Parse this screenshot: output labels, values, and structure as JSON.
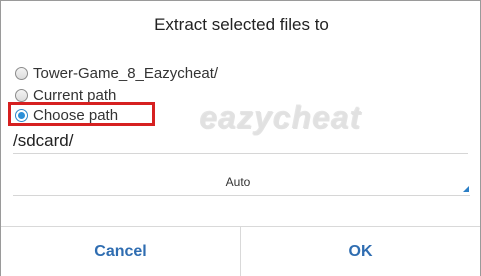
{
  "dialog": {
    "title": "Extract selected files to",
    "options": [
      {
        "label": "Tower-Game_8_Eazycheat/",
        "checked": false
      },
      {
        "label": "Current path",
        "checked": false
      },
      {
        "label": "Choose path",
        "checked": true
      }
    ],
    "path_value": "/sdcard/",
    "encoding_select": {
      "value": "Auto"
    },
    "cancel_label": "Cancel",
    "ok_label": "OK"
  },
  "watermark": {
    "text": "eazycheat"
  },
  "colors": {
    "accent": "#2b8fd8",
    "button_text": "#2f6db1",
    "highlight": "#d62020"
  },
  "icons": {
    "select_arrow": "dropdown-corner-triangle"
  }
}
